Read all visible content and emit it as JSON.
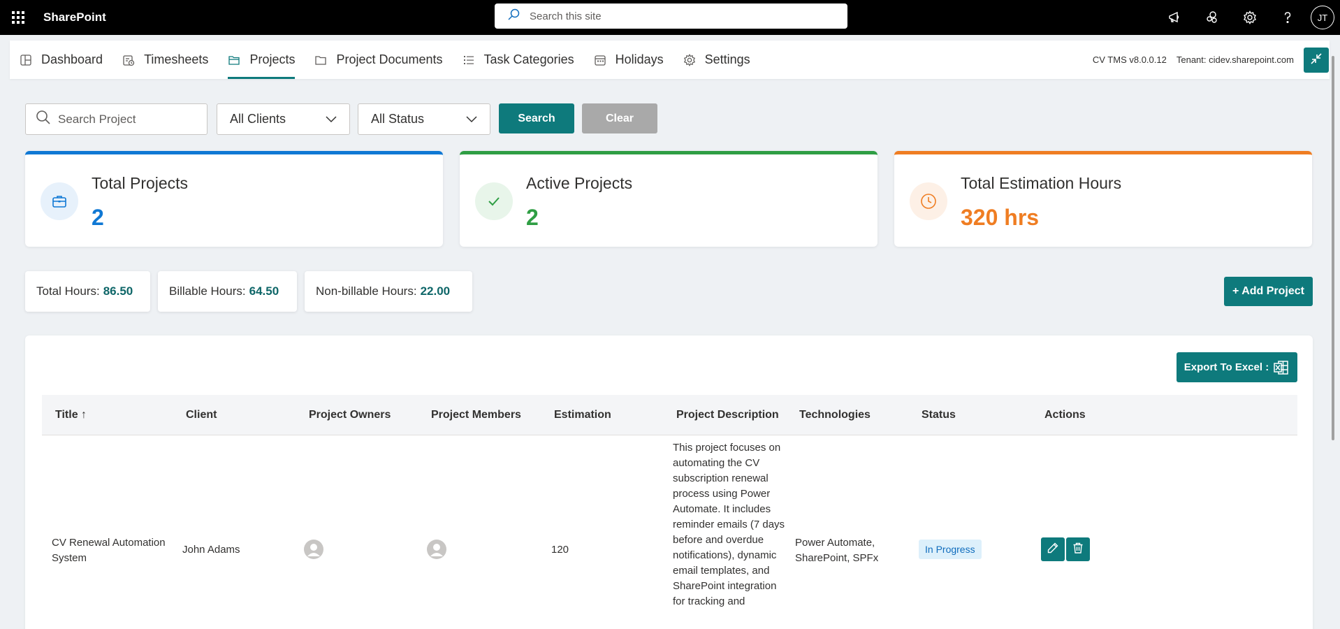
{
  "suite": {
    "brand": "SharePoint",
    "search_placeholder": "Search this site",
    "avatar_initials": "JT"
  },
  "nav": {
    "tabs": [
      {
        "label": "Dashboard",
        "icon": "dashboard-icon"
      },
      {
        "label": "Timesheets",
        "icon": "timesheet-icon"
      },
      {
        "label": "Projects",
        "icon": "projects-icon",
        "active": true
      },
      {
        "label": "Project Documents",
        "icon": "folder-icon"
      },
      {
        "label": "Task Categories",
        "icon": "list-icon"
      },
      {
        "label": "Holidays",
        "icon": "calendar-icon"
      },
      {
        "label": "Settings",
        "icon": "gear-icon"
      }
    ],
    "version": "CV TMS v8.0.0.12",
    "tenant": "Tenant: cidev.sharepoint.com"
  },
  "filters": {
    "search_placeholder": "Search Project",
    "client_selected": "All Clients",
    "status_selected": "All Status",
    "search_label": "Search",
    "clear_label": "Clear"
  },
  "stats": [
    {
      "title": "Total Projects",
      "value": "2",
      "color": "#0f78d4",
      "icon": "briefcase-icon"
    },
    {
      "title": "Active Projects",
      "value": "2",
      "color": "#2f9e44",
      "icon": "check-icon"
    },
    {
      "title": "Total Estimation Hours",
      "value": "320 hrs",
      "color": "#ef7d22",
      "icon": "clock-icon"
    }
  ],
  "hours": {
    "total_label": "Total Hours:",
    "total_value": "86.50",
    "billable_label": "Billable Hours:",
    "billable_value": "64.50",
    "nonbillable_label": "Non-billable Hours:",
    "nonbillable_value": "22.00"
  },
  "add_project_label": "+ Add Project",
  "export_label": "Export To Excel :",
  "table": {
    "columns": [
      "Title ↑",
      "Client",
      "Project Owners",
      "Project Members",
      "Estimation",
      "Project Description",
      "Technologies",
      "Status",
      "Actions"
    ],
    "rows": [
      {
        "title": "CV Renewal Automation System",
        "client": "John Adams",
        "estimation": "120",
        "description": "This project focuses on automating the CV subscription renewal process using Power Automate. It includes reminder emails (7 days before and overdue notifications), dynamic email templates, and SharePoint integration for tracking and",
        "technologies": "Power Automate, SharePoint, SPFx",
        "status": "In Progress"
      }
    ]
  },
  "colors": {
    "accent": "#0e7a7c",
    "clear_button": "#a9a9a9",
    "status_badge_bg": "#ddf0fb",
    "status_badge_text": "#0f6cbd"
  }
}
